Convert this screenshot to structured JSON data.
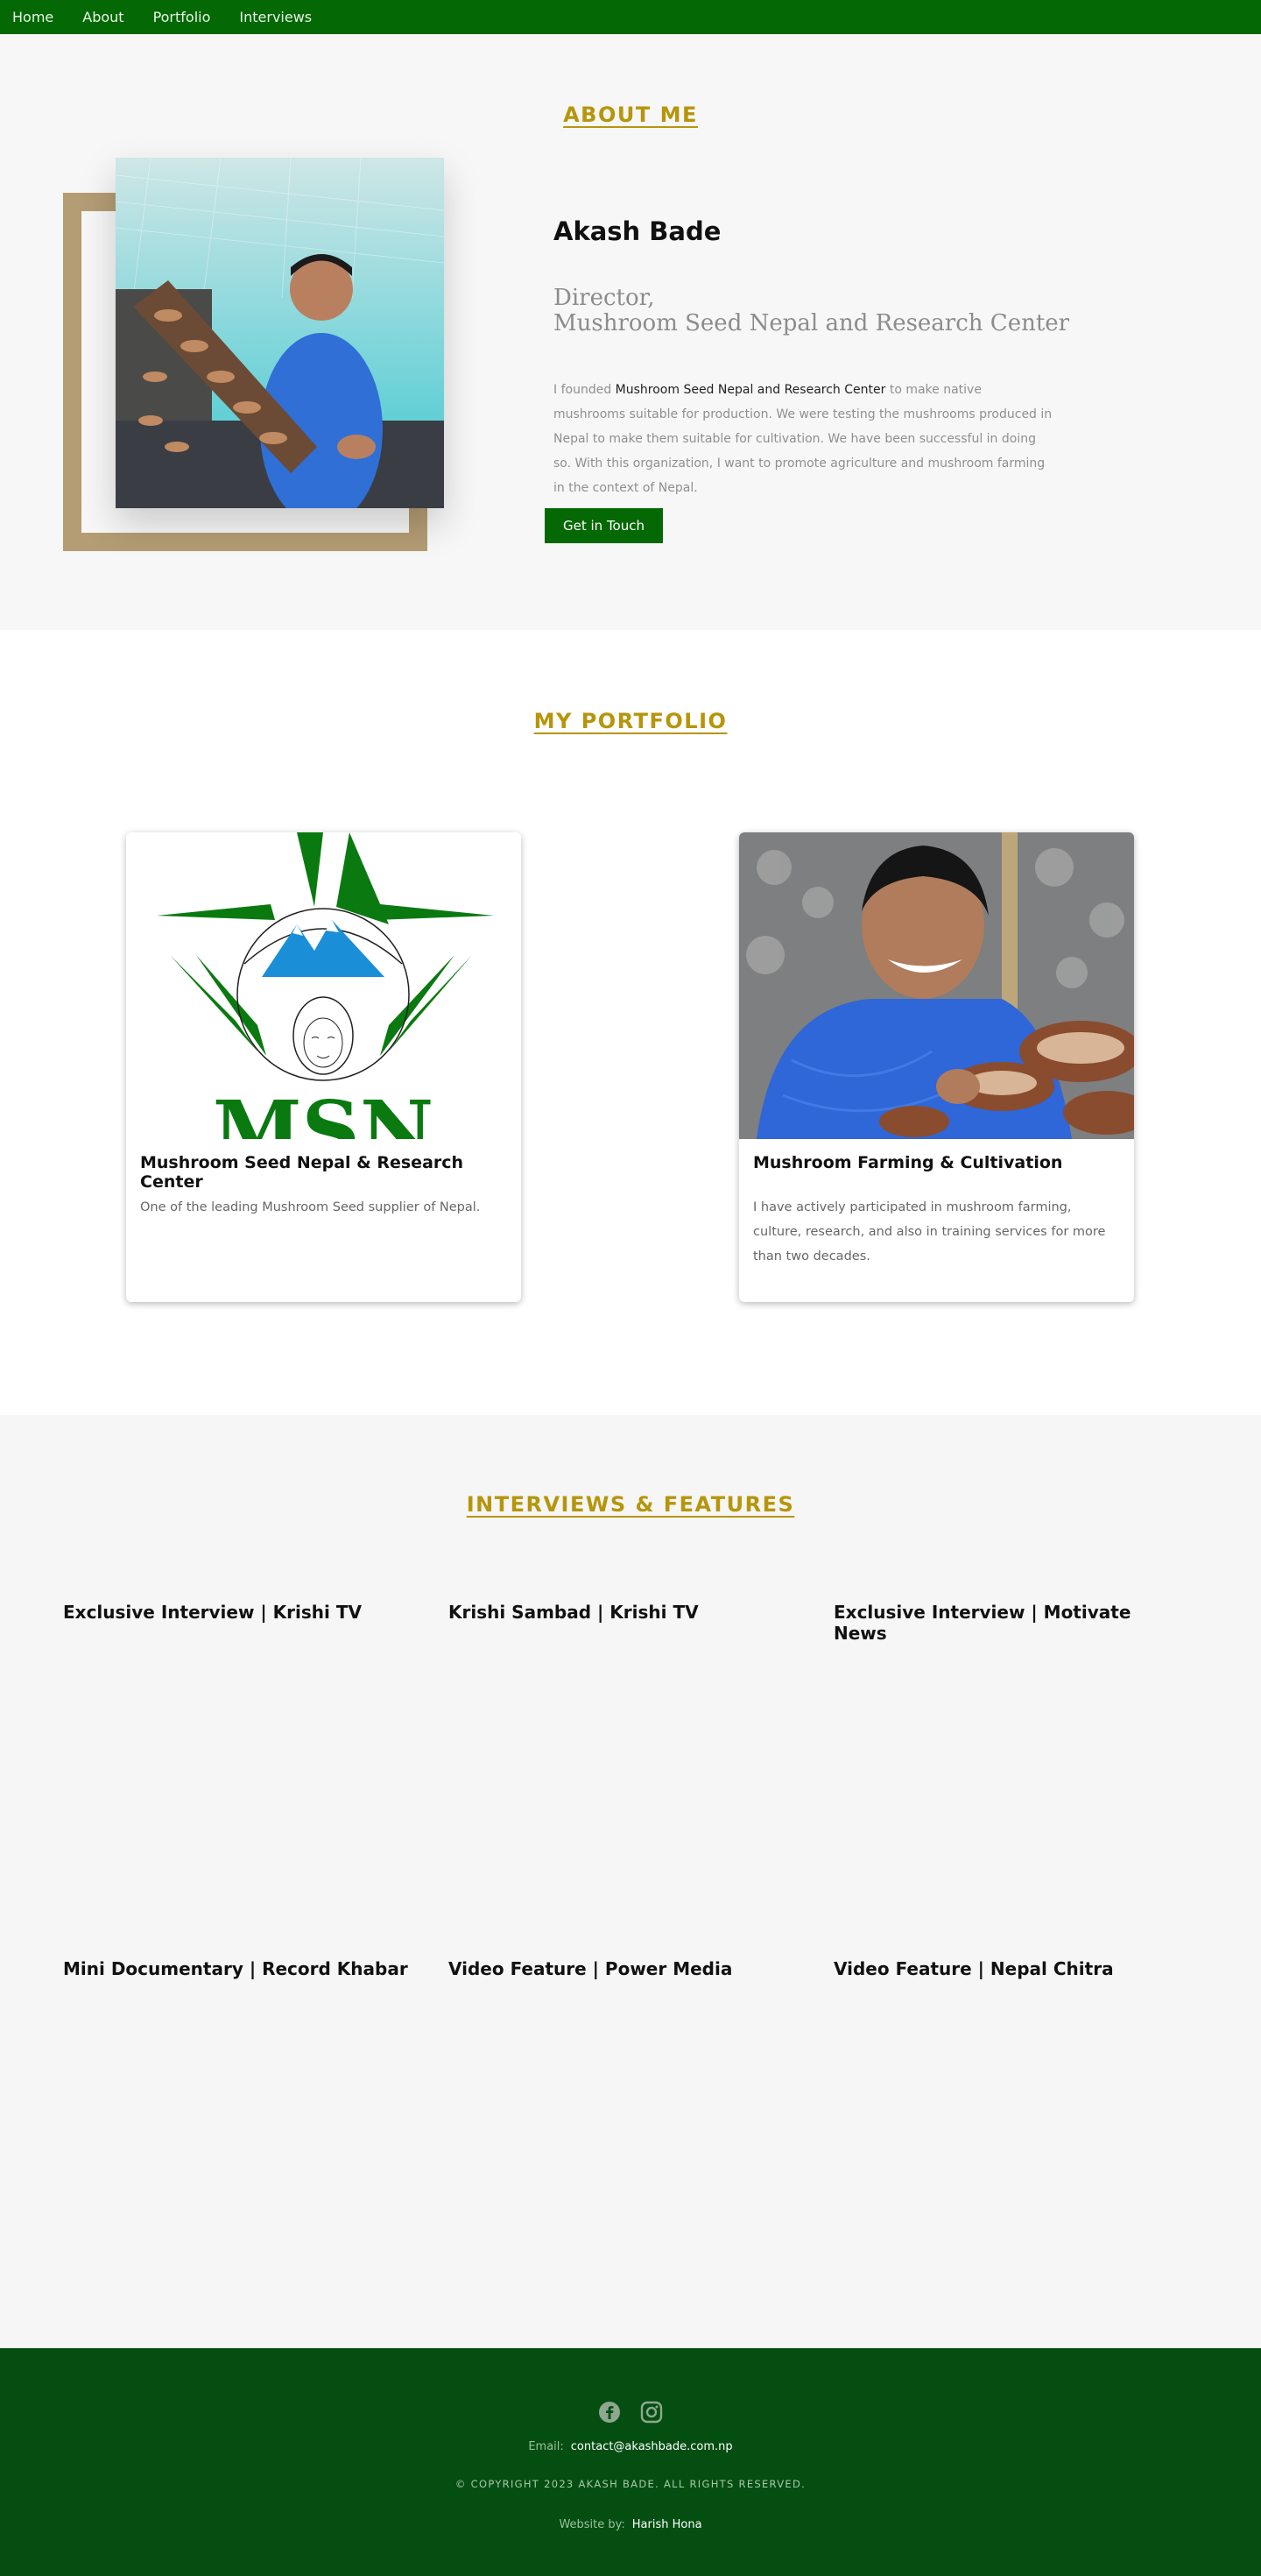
{
  "nav": {
    "items": [
      {
        "label": "Home"
      },
      {
        "label": "About"
      },
      {
        "label": "Portfolio"
      },
      {
        "label": "Interviews"
      }
    ]
  },
  "about": {
    "section_title": "ABOUT ME",
    "name": "Akash Bade",
    "role_line1": "Director,",
    "role_line2": "Mushroom Seed Nepal and Research Center",
    "bio_prefix": "I founded ",
    "bio_highlight": "Mushroom Seed Nepal and Research Center",
    "bio_suffix": " to make native mushrooms suitable for production. We were testing the mushrooms produced in Nepal to make them suitable for cultivation. We have been successful in doing so. With this organization, I want to promote agriculture and mushroom farming in the context of Nepal.",
    "button_label": "Get in Touch"
  },
  "portfolio": {
    "section_title": "MY PORTFOLIO",
    "cards": [
      {
        "title": "Mushroom Seed Nepal & Research Center",
        "description": "One of the leading Mushroom Seed supplier of Nepal.",
        "logo_text": "MSN"
      },
      {
        "title": "Mushroom Farming & Cultivation",
        "description": "I have actively participated in mushroom farming, culture, research, and also in training services for more than two decades."
      }
    ]
  },
  "interviews": {
    "section_title": "INTERVIEWS & FEATURES",
    "videos": [
      {
        "title": "Exclusive Interview | Krishi TV"
      },
      {
        "title": "Krishi Sambad | Krishi TV"
      },
      {
        "title": "Exclusive Interview | Motivate News"
      },
      {
        "title": "Mini Documentary | Record Khabar"
      },
      {
        "title": "Video Feature | Power Media"
      },
      {
        "title": "Video Feature | Nepal Chitra"
      }
    ]
  },
  "footer": {
    "social": [
      {
        "icon": "facebook-icon"
      },
      {
        "icon": "instagram-icon"
      }
    ],
    "email_label": "Email:",
    "email_value": "contact@akashbade.com.np",
    "copyright": "© COPYRIGHT 2023 AKASH BADE. ALL RIGHTS RESERVED.",
    "credit_label": "Website by:",
    "credit_value": "Harish Hona"
  },
  "colors": {
    "nav_bg": "#046804",
    "accent_gold": "#b7950b",
    "button_green": "#046804",
    "footer_bg": "#044e12",
    "frame_tan": "#b49c74"
  }
}
